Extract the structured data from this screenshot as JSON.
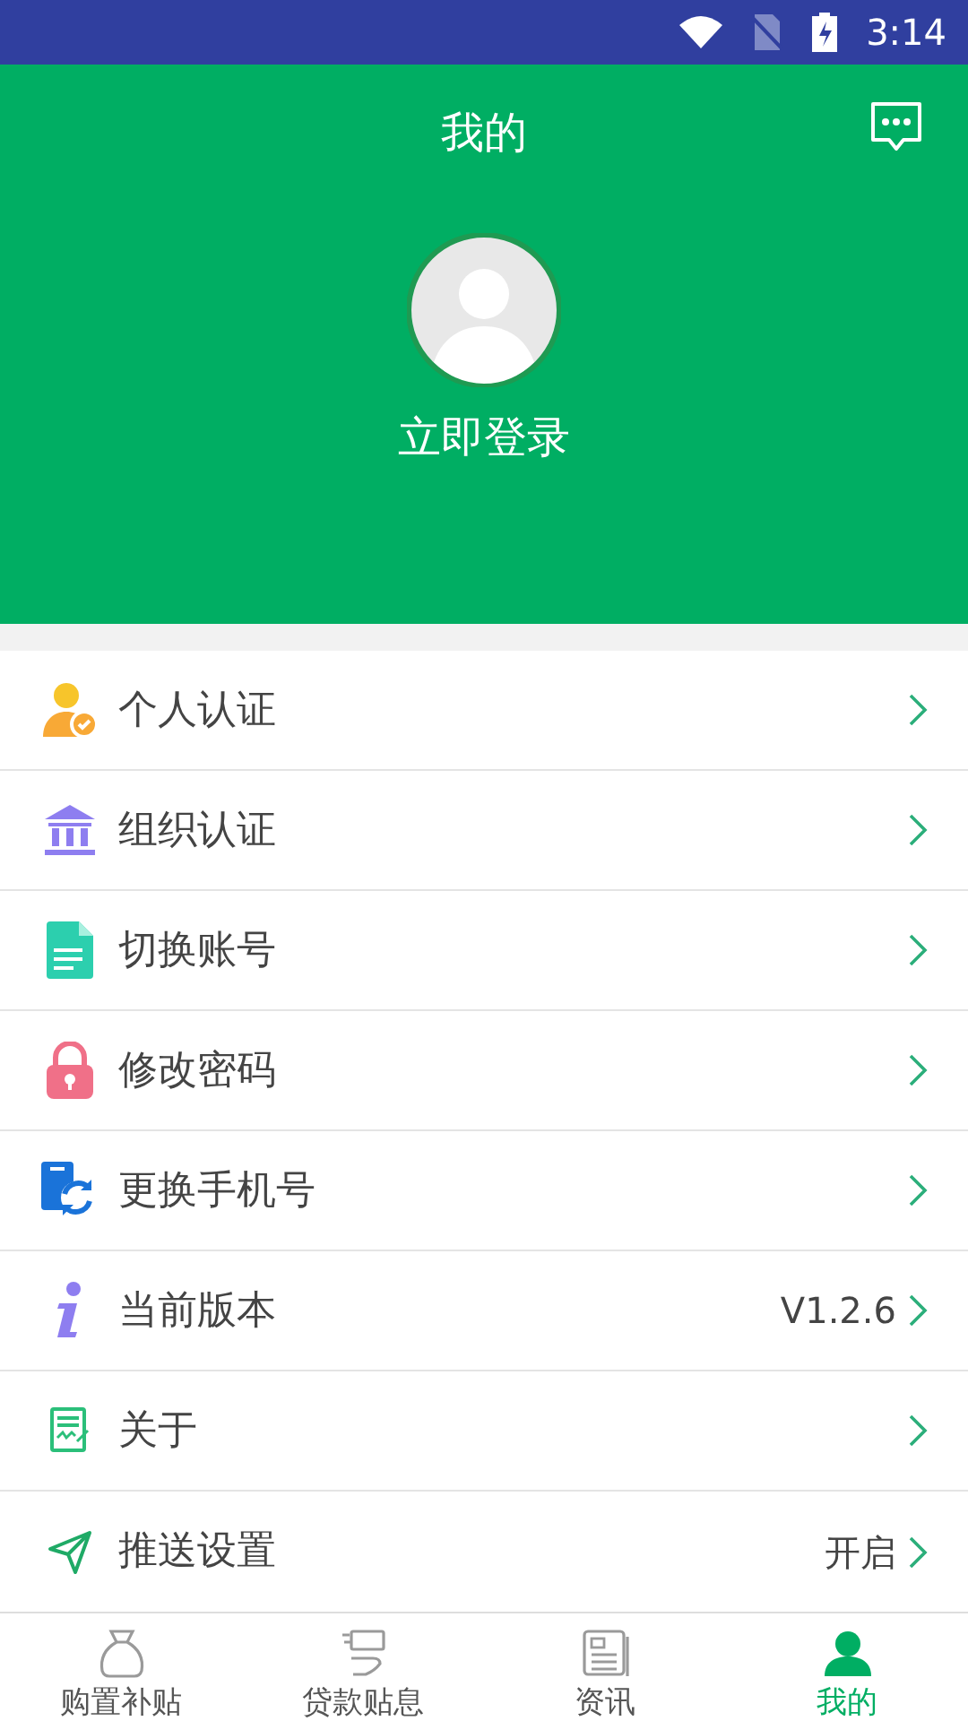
{
  "status_bar": {
    "time": "3:14"
  },
  "header": {
    "title": "我的",
    "login": "立即登录"
  },
  "menu": [
    {
      "label": "个人认证"
    },
    {
      "label": "组织认证"
    },
    {
      "label": "切换账号"
    },
    {
      "label": "修改密码"
    },
    {
      "label": "更换手机号"
    },
    {
      "label": "当前版本",
      "value": "V1.2.6"
    },
    {
      "label": "关于"
    },
    {
      "label": "推送设置",
      "value": "开启"
    }
  ],
  "tabs": [
    {
      "label": "购置补贴",
      "selected": false
    },
    {
      "label": "贷款贴息",
      "selected": false
    },
    {
      "label": "资讯",
      "selected": false
    },
    {
      "label": "我的",
      "selected": true
    }
  ]
}
